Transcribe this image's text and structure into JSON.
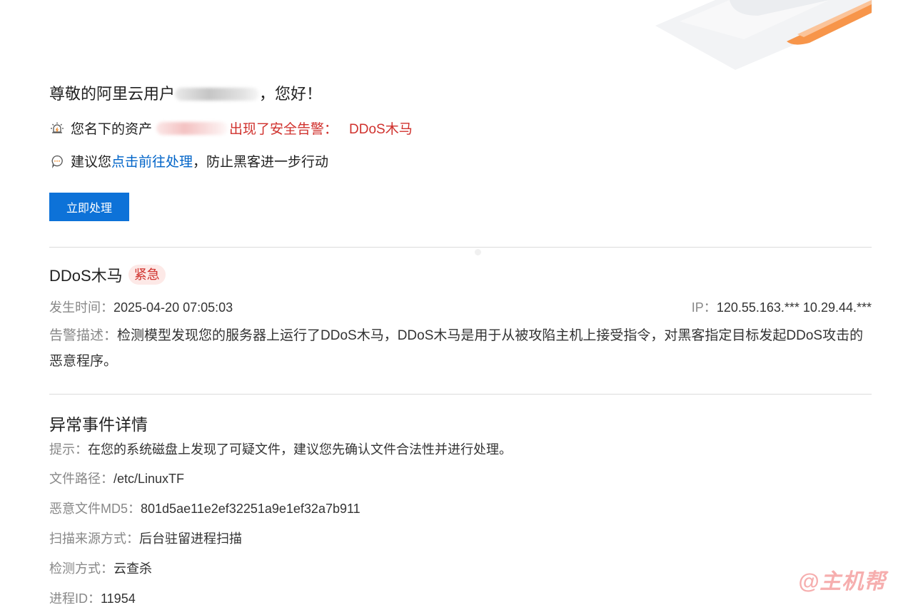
{
  "header": {
    "greeting_prefix": "尊敬的阿里云用户",
    "greeting_suffix": "，您好！"
  },
  "alert_notice": {
    "prefix": "您名下的资产",
    "middle": "出现了安全告警：",
    "alert_name": "DDoS木马"
  },
  "advice": {
    "prefix": "建议您",
    "link_text": "点击前往处理",
    "suffix": "，防止黑客进一步行动"
  },
  "actions": {
    "handle_now_label": "立即处理"
  },
  "alert": {
    "title": "DDoS木马",
    "severity": "紧急",
    "time_label": "发生时间：",
    "time_value": "2025-04-20 07:05:03",
    "ip_label": "IP：",
    "ip_value": "120.55.163.*** 10.29.44.***",
    "desc_label": "告警描述：",
    "desc_value": "检测模型发现您的服务器上运行了DDoS木马，DDoS木马是用于从被攻陷主机上接受指令，对黑客指定目标发起DDoS攻击的恶意程序。"
  },
  "details": {
    "title": "异常事件详情",
    "rows": [
      {
        "label": "提示：",
        "value": "在您的系统磁盘上发现了可疑文件，建议您先确认文件合法性并进行处理。"
      },
      {
        "label": "文件路径：",
        "value": "/etc/LinuxTF"
      },
      {
        "label": "恶意文件MD5：",
        "value": "801d5ae11e2ef32251a9e1ef32a7b911"
      },
      {
        "label": "扫描来源方式：",
        "value": "后台驻留进程扫描"
      },
      {
        "label": "检测方式：",
        "value": "云查杀"
      },
      {
        "label": "进程ID：",
        "value": "11954"
      }
    ]
  },
  "watermark": {
    "text": "@主机帮"
  },
  "colors": {
    "primary": "#0d72d8",
    "danger": "#d0312d",
    "link": "#0064c8",
    "accent_orange": "#f7954a"
  },
  "icons": {
    "alert": "warning-light-icon",
    "advice": "chat-bubble-icon"
  }
}
